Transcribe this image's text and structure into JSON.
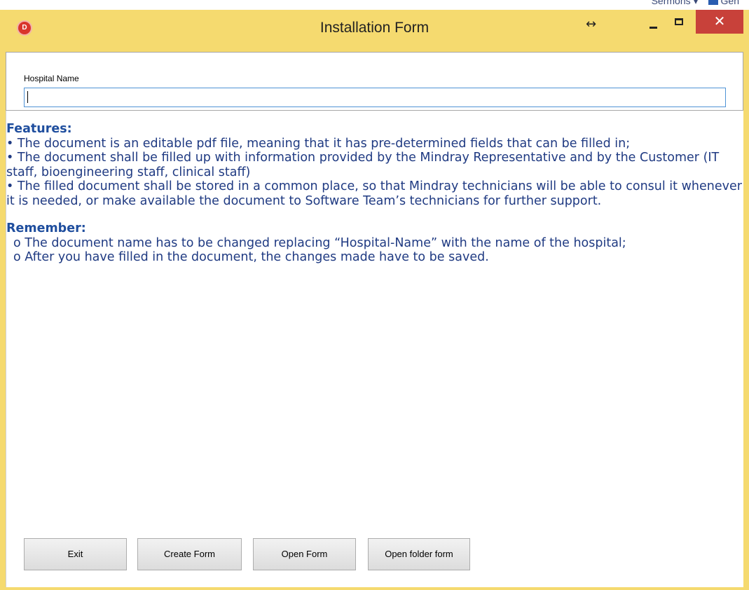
{
  "background_window": {
    "peek_text": "Sermons ▾",
    "peek_text_2": "Gen"
  },
  "window": {
    "title": "Installation Form",
    "app_icon_letter": "D",
    "controls": {
      "resize": "↔",
      "close": "✕"
    },
    "accent_color": "#f5da6f"
  },
  "form": {
    "hospital_name_label": "Hospital Name",
    "hospital_name_value": ""
  },
  "info": {
    "features_heading": "Features:",
    "features": [
      "• The document is an editable pdf file, meaning that it has pre-determined fields that can be filled in;",
      "• The document shall be filled up with information provided by the Mindray Representative and by the Customer (IT staff, bioengineering staff, clinical staff)",
      "• The filled document shall be stored in a common place, so that Mindray technicians will be able to consul it whenever it is needed, or make available the document to Software Team’s technicians for further support."
    ],
    "remember_heading": "Remember:",
    "remember": [
      "o The document name has to be changed replacing “Hospital-Name” with the name of the hospital;",
      "o After you have filled in the document, the changes made have to be saved."
    ]
  },
  "buttons": {
    "exit": "Exit",
    "create_form": "Create Form",
    "open_form": "Open Form",
    "open_folder_form": "Open folder form"
  }
}
